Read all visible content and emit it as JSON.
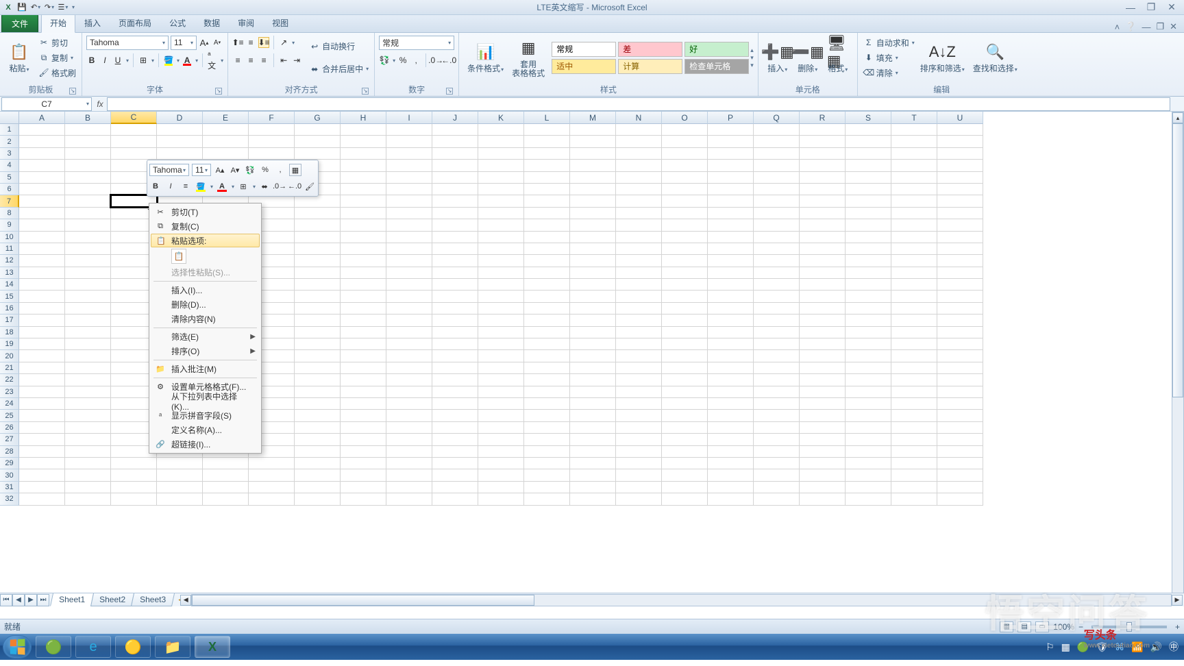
{
  "title": "LTE英文缩写 - Microsoft Excel",
  "qat_icons": [
    "excel-icon",
    "save-icon",
    "undo-icon",
    "redo-icon",
    "print-icon"
  ],
  "tabs": {
    "file": "文件",
    "list": [
      "开始",
      "插入",
      "页面布局",
      "公式",
      "数据",
      "审阅",
      "视图"
    ],
    "active": 0
  },
  "ribbon": {
    "clipboard": {
      "paste": "粘贴",
      "cut": "剪切",
      "copy": "复制",
      "fmtpainter": "格式刷",
      "label": "剪贴板"
    },
    "font": {
      "name": "Tahoma",
      "size": "11",
      "label": "字体"
    },
    "align": {
      "wrap": "自动换行",
      "merge": "合并后居中",
      "label": "对齐方式"
    },
    "number": {
      "fmt": "常规",
      "label": "数字"
    },
    "styles": {
      "condfmt": "条件格式",
      "tblFmt": "套用\n表格格式",
      "cells": [
        {
          "t": "常规",
          "bg": "#ffffff",
          "c": "#000"
        },
        {
          "t": "差",
          "bg": "#ffc7ce",
          "c": "#9c0006"
        },
        {
          "t": "好",
          "bg": "#c6efce",
          "c": "#006100"
        },
        {
          "t": "适中",
          "bg": "#ffeb9c",
          "c": "#9c5700"
        },
        {
          "t": "计算",
          "bg": "#ffeeba",
          "c": "#876300"
        },
        {
          "t": "检查单元格",
          "bg": "#a5a5a5",
          "c": "#ffffff"
        }
      ],
      "label": "样式"
    },
    "cellsGrp": {
      "insert": "插入",
      "delete": "删除",
      "format": "格式",
      "label": "单元格"
    },
    "editing": {
      "sum": "自动求和",
      "fill": "填充",
      "clear": "清除",
      "sort": "排序和筛选",
      "find": "查找和选择",
      "label": "编辑"
    }
  },
  "namebox": "C7",
  "cols": [
    "A",
    "B",
    "C",
    "D",
    "E",
    "F",
    "G",
    "H",
    "I",
    "J",
    "K",
    "L",
    "M",
    "N",
    "O",
    "P",
    "Q",
    "R",
    "S",
    "T",
    "U"
  ],
  "rowcount": 32,
  "selected": {
    "col": "C",
    "row": 7
  },
  "miniToolbar": {
    "font": "Tahoma",
    "size": "11"
  },
  "contextMenu": [
    {
      "t": "剪切(T)",
      "ico": "✂"
    },
    {
      "t": "复制(C)",
      "ico": "⧉"
    },
    {
      "t": "粘贴选项:",
      "ico": "📋",
      "header": true,
      "hov": true
    },
    {
      "pasteOpts": true
    },
    {
      "t": "选择性粘贴(S)...",
      "dis": true
    },
    {
      "sep": true
    },
    {
      "t": "插入(I)..."
    },
    {
      "t": "删除(D)..."
    },
    {
      "t": "清除内容(N)"
    },
    {
      "sep": true
    },
    {
      "t": "筛选(E)",
      "sub": true
    },
    {
      "t": "排序(O)",
      "sub": true
    },
    {
      "sep": true
    },
    {
      "t": "插入批注(M)",
      "ico": "📁"
    },
    {
      "sep": true
    },
    {
      "t": "设置单元格格式(F)...",
      "ico": "⚙"
    },
    {
      "t": "从下拉列表中选择(K)..."
    },
    {
      "t": "显示拼音字段(S)",
      "ico": "ᵃ"
    },
    {
      "t": "定义名称(A)..."
    },
    {
      "t": "超链接(I)...",
      "ico": "🔗"
    }
  ],
  "sheets": [
    "Sheet1",
    "Sheet2",
    "Sheet3"
  ],
  "activeSheet": 0,
  "status": "就绪",
  "zoom": "100%",
  "watermark": "悟空问答",
  "watermark2": "写头条",
  "watermark2sub": "www.xietoutiao.com"
}
